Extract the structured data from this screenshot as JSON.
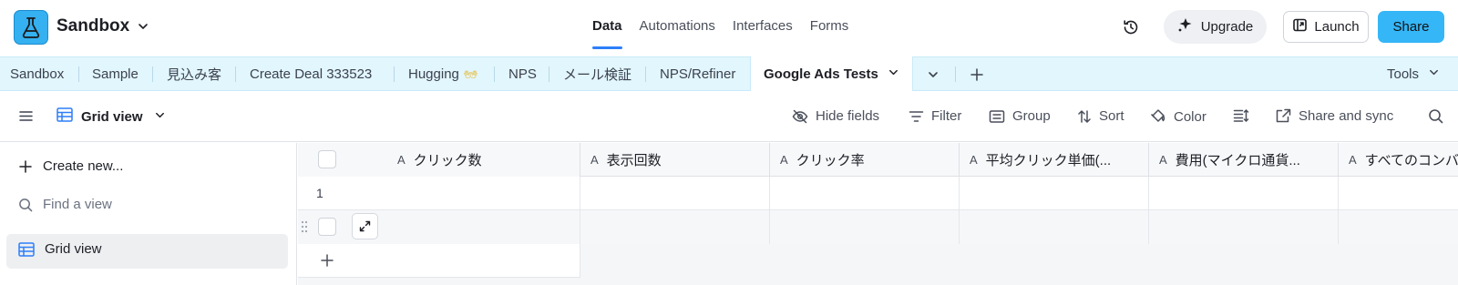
{
  "header": {
    "base_name": "Sandbox",
    "nav": [
      "Data",
      "Automations",
      "Interfaces",
      "Forms"
    ],
    "active_nav": "Data",
    "upgrade_label": "Upgrade",
    "launch_label": "Launch",
    "share_label": "Share",
    "colors": {
      "logo": "#35b0f0",
      "share": "#35b6f7",
      "accent": "#2d7ff9"
    }
  },
  "tables": {
    "tabs": [
      "Sandbox",
      "Sample",
      "見込み客",
      "Create Deal 333523",
      "Hugging",
      "NPS",
      "メール検証",
      "NPS/Refiner"
    ],
    "active_tab": "Google Ads Tests",
    "tools_label": "Tools",
    "colors": {
      "bar_bg": "#e2f6fd"
    }
  },
  "viewbar": {
    "view_name": "Grid view",
    "hide_fields": "Hide fields",
    "filter": "Filter",
    "group": "Group",
    "sort": "Sort",
    "color": "Color",
    "share_sync": "Share and sync"
  },
  "sidebar": {
    "create_new": "Create new...",
    "find_placeholder": "Find a view",
    "views": [
      {
        "label": "Grid view",
        "active": true
      }
    ]
  },
  "grid": {
    "columns": [
      "クリック数",
      "表示回数",
      "クリック率",
      "平均クリック単価(...",
      "費用(マイクロ通貨...",
      "すべてのコンバ"
    ],
    "field_type_icon": "A",
    "rows": [
      {
        "number": "1",
        "cells": [
          "",
          "",
          "",
          "",
          "",
          ""
        ]
      },
      {
        "number": "",
        "cells": [
          "",
          "",
          "",
          "",
          "",
          ""
        ]
      }
    ]
  }
}
